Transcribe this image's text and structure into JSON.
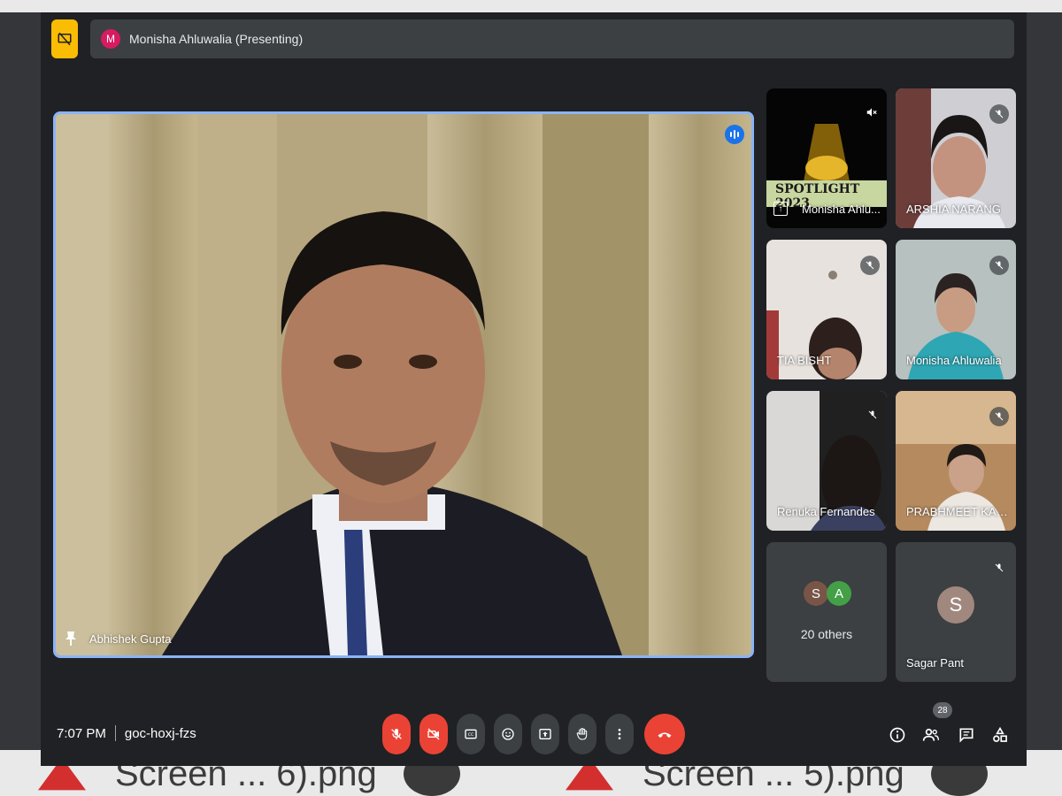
{
  "presenting_bar": {
    "avatar_letter": "M",
    "label": "Monisha Ahluwalia (Presenting)"
  },
  "main_speaker": {
    "name": "Abhishek Gupta"
  },
  "tiles": [
    {
      "name": "Monisha Ahlu...",
      "overlay_text": "SPOTLIGHT 2023"
    },
    {
      "name": "ARSHIA NARANG"
    },
    {
      "name": "TIA BISHT"
    },
    {
      "name": "Monisha Ahluwalia"
    },
    {
      "name": "Renuka Fernandes"
    },
    {
      "name": "PRABHMEET KAUR"
    }
  ],
  "others_tile": {
    "avatars": [
      "S",
      "A"
    ],
    "label": "20 others",
    "colors": [
      "#795548",
      "#43a047"
    ]
  },
  "sagar_tile": {
    "avatar_letter": "S",
    "name": "Sagar Pant"
  },
  "meeting_info": {
    "time": "7:07 PM",
    "code": "goc-hoxj-fzs"
  },
  "controls": [
    "mic-off",
    "camera-off",
    "captions",
    "emoji",
    "present",
    "raise-hand",
    "more",
    "end-call"
  ],
  "right_controls": {
    "people_count": "28"
  },
  "background_files": [
    "Screen ... 6).png",
    "Screen ... 5).png"
  ],
  "colors": {
    "accent_blue": "#8ab4f8",
    "danger_red": "#ea4335",
    "surface": "#202124",
    "tile_bg": "#3c4043"
  }
}
